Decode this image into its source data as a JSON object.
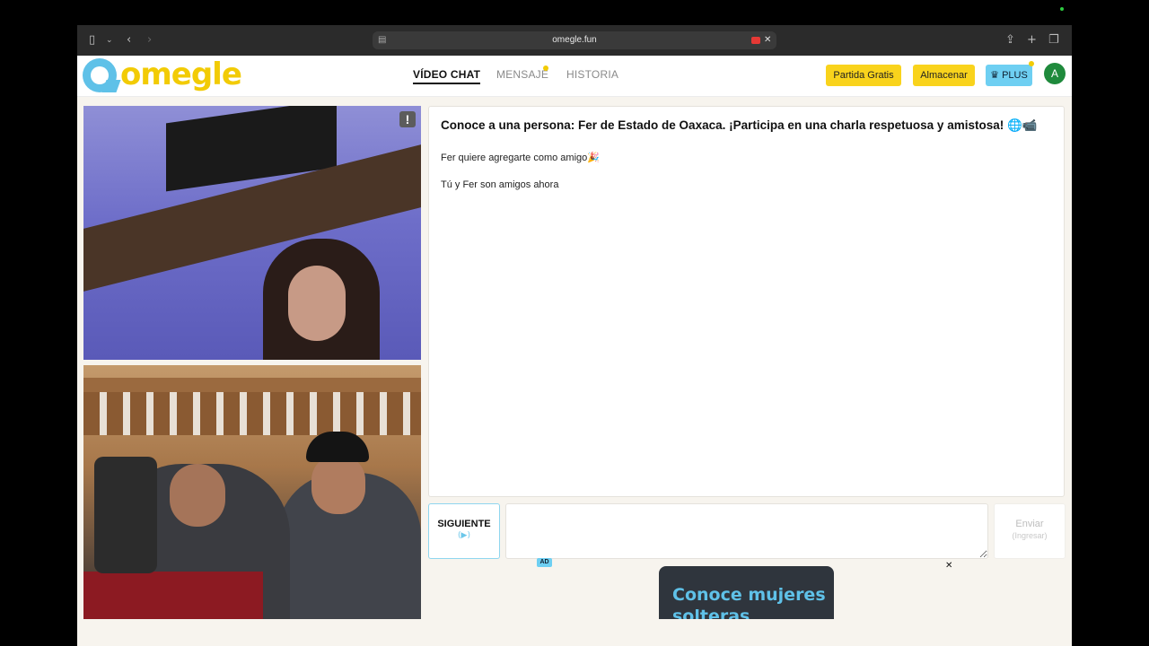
{
  "browser": {
    "url": "omegle.fun",
    "icons": [
      "sidebar-icon",
      "chevron-down-icon",
      "back-icon",
      "forward-icon",
      "page-settings-icon",
      "camera-recording-icon",
      "close-icon",
      "share-icon",
      "new-tab-icon",
      "tabs-overview-icon"
    ]
  },
  "site": {
    "logo_text": "omegle",
    "nav": {
      "video_chat": "VÍDEO CHAT",
      "mensaje": "MENSAJE",
      "historia": "HISTORIA"
    },
    "buttons": {
      "partida": "Partida Gratis",
      "almacenar": "Almacenar",
      "plus": "♛ PLUS"
    },
    "avatar_initial": "A"
  },
  "videos": {
    "report_icon": "!"
  },
  "chat": {
    "intro": "Conoce a una persona: Fer de Estado de Oaxaca. ¡Participa en una charla respetuosa y amistosa! 🌐📹",
    "messages": [
      "Fer quiere agregarte como amigo🎉",
      "Tú y Fer son amigos ahora"
    ]
  },
  "controls": {
    "next_label": "SIGUIENTE",
    "next_icon": "(▶)",
    "message_value": "",
    "message_placeholder": "",
    "send_label": "Enviar",
    "send_hint": "(Ingresar)"
  },
  "ad": {
    "badge": "AD",
    "close": "✕",
    "title": "Conoce mujeres solteras"
  },
  "colors": {
    "brand_yellow": "#f2cb05",
    "brand_blue": "#5fc1e8",
    "avatar_green": "#1f8a3c",
    "button_yellow": "#f9d31c",
    "plus_blue": "#6ecff2"
  }
}
